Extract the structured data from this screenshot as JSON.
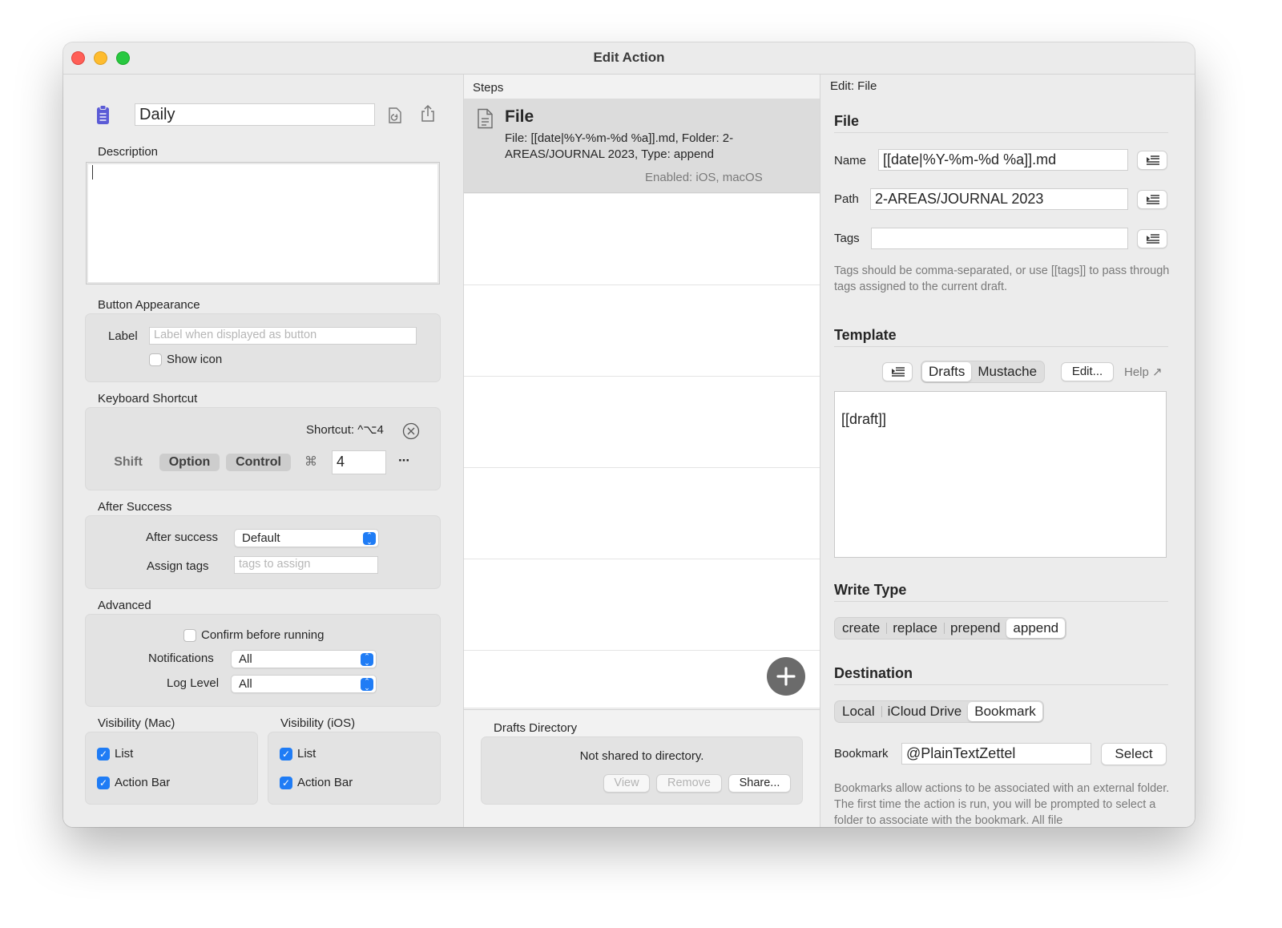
{
  "window": {
    "title": "Edit Action"
  },
  "left": {
    "action_name": "Daily",
    "description_label": "Description",
    "description_value": "",
    "button_appearance": {
      "title": "Button Appearance",
      "label_label": "Label",
      "label_placeholder": "Label when displayed as button",
      "show_icon_label": "Show icon",
      "show_icon_checked": false
    },
    "keyboard_shortcut": {
      "title": "Keyboard Shortcut",
      "shortcut_text": "Shortcut: ^⌥4",
      "shift_label": "Shift",
      "shift_on": false,
      "option_label": "Option",
      "option_on": true,
      "control_label": "Control",
      "control_on": true,
      "command_glyph": "⌘",
      "key_value": "4",
      "more_glyph": "···"
    },
    "after_success": {
      "title": "After Success",
      "after_success_label": "After success",
      "after_success_value": "Default",
      "assign_tags_label": "Assign tags",
      "assign_tags_placeholder": "tags to assign"
    },
    "advanced": {
      "title": "Advanced",
      "confirm_label": "Confirm before running",
      "confirm_checked": false,
      "notifications_label": "Notifications",
      "notifications_value": "All",
      "log_level_label": "Log Level",
      "log_level_value": "All"
    },
    "visibility_mac": {
      "title": "Visibility (Mac)",
      "list_label": "List",
      "list_checked": true,
      "action_bar_label": "Action Bar",
      "action_bar_checked": true
    },
    "visibility_ios": {
      "title": "Visibility (iOS)",
      "list_label": "List",
      "list_checked": true,
      "action_bar_label": "Action Bar",
      "action_bar_checked": true
    }
  },
  "middle": {
    "header": "Steps",
    "steps": [
      {
        "title": "File",
        "description": "File: [[date|%Y-%m-%d %a]].md, Folder: 2-AREAS/JOURNAL 2023, Type: append",
        "enabled": "Enabled: iOS, macOS"
      }
    ],
    "drafts_directory": {
      "title": "Drafts Directory",
      "status": "Not shared to directory.",
      "view_label": "View",
      "remove_label": "Remove",
      "share_label": "Share..."
    }
  },
  "right": {
    "header": "Edit: File",
    "file": {
      "title": "File",
      "name_label": "Name",
      "name_value": "[[date|%Y-%m-%d %a]].md",
      "path_label": "Path",
      "path_value": "2-AREAS/JOURNAL 2023",
      "tags_label": "Tags",
      "tags_value": "",
      "tags_note": "Tags should be comma-separated, or use [[tags]] to pass through tags assigned to the current draft."
    },
    "template": {
      "title": "Template",
      "syntax_options": [
        "Drafts",
        "Mustache"
      ],
      "syntax_selected": "Drafts",
      "edit_label": "Edit...",
      "help_label": "Help ↗",
      "content": "[[draft]]"
    },
    "write_type": {
      "title": "Write Type",
      "options": [
        "create",
        "replace",
        "prepend",
        "append"
      ],
      "selected": "append"
    },
    "destination": {
      "title": "Destination",
      "options": [
        "Local",
        "iCloud Drive",
        "Bookmark"
      ],
      "selected": "Bookmark",
      "bookmark_label": "Bookmark",
      "bookmark_value": "@PlainTextZettel",
      "select_label": "Select",
      "note": "Bookmarks allow actions to be associated with an external folder. The first time the action is run, you will be prompted to select a folder to associate with the bookmark. All file"
    }
  },
  "colors": {
    "accent": "#1f7cf5",
    "action_icon": "#5b5bd6",
    "add_button": "#6b6b6b",
    "selected_step": "#dcdcdc"
  }
}
